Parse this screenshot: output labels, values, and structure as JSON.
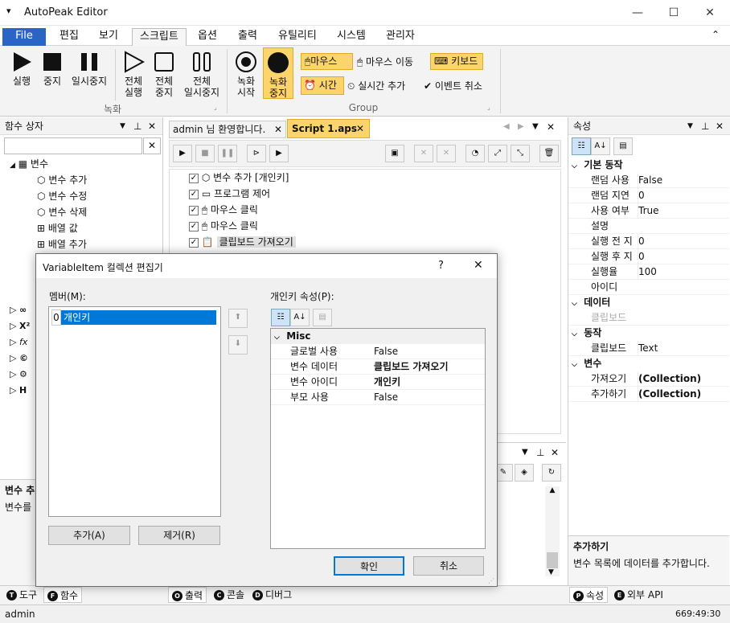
{
  "app": {
    "title": "AutoPeak Editor",
    "menu_glyph": "▾"
  },
  "window_controls": {
    "min": "—",
    "max": "☐",
    "close": "✕"
  },
  "menu": [
    "File",
    "편집",
    "보기",
    "스크립트",
    "옵션",
    "출력",
    "유틸리티",
    "시스템",
    "관리자"
  ],
  "menu_selected": "스크립트",
  "collapse_glyph": "⌃",
  "ribbon": {
    "run": "실행",
    "stop": "중지",
    "pause": "일시중지",
    "all_run": [
      "전체",
      "실행"
    ],
    "all_stop": [
      "전체",
      "중지"
    ],
    "all_pause": [
      "전체",
      "일시중지"
    ],
    "record_group": "녹화",
    "record_start": [
      "녹화",
      "시작"
    ],
    "record_stop": [
      "녹화",
      "중지"
    ],
    "mouse": "마우스",
    "mouse_move": "마우스 이동",
    "keyboard": "키보드",
    "time": "시간",
    "realtime_add": "실시간 추가",
    "event_cancel": "이벤트 취소",
    "group_label": "Group"
  },
  "func_panel": {
    "title": "함수 상자",
    "root": "변수",
    "items": [
      "변수 추가",
      "변수 수정",
      "변수 삭제",
      "배열 값",
      "배열 추가"
    ],
    "desc_title": "변수 추",
    "desc_text": "변수를"
  },
  "tabs": {
    "welcome": "admin 님 환영합니다.",
    "script": "Script 1.aps"
  },
  "script_lines": [
    "변수 추가 [개인키]",
    "프로그램 제어",
    "마우스 클릭",
    "마우스 클릭",
    "클립보드 가져오기"
  ],
  "props_panel": {
    "title": "속성",
    "cat_basic": "기본 동작",
    "basic": [
      [
        "랜덤 사용",
        "False"
      ],
      [
        "랜덤 지연",
        "0"
      ],
      [
        "사용 여부",
        "True"
      ],
      [
        "설명",
        ""
      ],
      [
        "실행 전 지",
        "0"
      ],
      [
        "실행 후 지",
        "0"
      ],
      [
        "실행율",
        "100"
      ],
      [
        "아이디",
        ""
      ]
    ],
    "cat_data": "데이터",
    "data": [
      [
        "클립보드",
        ""
      ]
    ],
    "cat_action": "동작",
    "action": [
      [
        "클립보드",
        "Text"
      ]
    ],
    "cat_var": "변수",
    "var": [
      [
        "가져오기",
        "(Collection)"
      ],
      [
        "추가하기",
        "(Collection)"
      ]
    ],
    "desc_title": "추가하기",
    "desc_text": "변수 목록에 데이터를 추가합니다."
  },
  "dialog": {
    "title": "VariableItem 컬렉션 편집기",
    "help": "?",
    "close": "✕",
    "members_label": "멤버(M):",
    "members": [
      {
        "index": "0",
        "name": "개인키"
      }
    ],
    "add": "추가(A)",
    "remove": "제거(R)",
    "props_label": "개인키 속성(P):",
    "cat": "Misc",
    "props": [
      [
        "글로벌 사용",
        "False",
        false
      ],
      [
        "변수 데이터",
        "클립보드 가져오기",
        true
      ],
      [
        "변수 아이디",
        "개인키",
        true
      ],
      [
        "부모 사용",
        "False",
        false
      ]
    ],
    "ok": "확인",
    "cancel": "취소"
  },
  "bottom_tabs_left": [
    {
      "key": "T",
      "label": "도구"
    },
    {
      "key": "F",
      "label": "함수"
    }
  ],
  "bottom_tabs_mid": [
    {
      "key": "O",
      "label": "출력"
    },
    {
      "key": "C",
      "label": "콘솔"
    },
    {
      "key": "D",
      "label": "디버그"
    }
  ],
  "bottom_tabs_right": [
    {
      "key": "P",
      "label": "속성"
    },
    {
      "key": "E",
      "label": "외부 API"
    }
  ],
  "status": {
    "user": "admin",
    "time": "669:49:30"
  }
}
